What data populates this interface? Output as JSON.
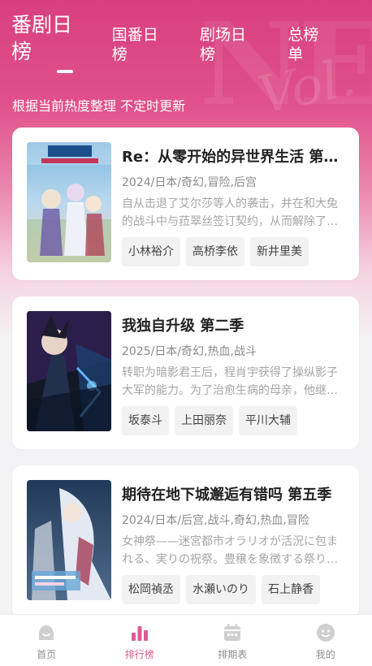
{
  "header": {
    "tabs": [
      {
        "label": "番剧日榜",
        "active": true
      },
      {
        "label": "国番日榜",
        "active": false
      },
      {
        "label": "剧场日榜",
        "active": false
      },
      {
        "label": "总榜单",
        "active": false
      }
    ],
    "subtitle": "根据当前热度整理 不定时更新"
  },
  "list": [
    {
      "title": "Re：从零开始的异世界生活 第三季",
      "meta": "2024/日本/奇幻,冒险,后宫",
      "desc": "自从击退了艾尔莎等人的袭击，并在和大兔的战斗中与菈翠丝签订契约，从而解除了诅咒之后，一行人回到了王都。",
      "cast": [
        "小林裕介",
        "高桥李依",
        "新井里美"
      ]
    },
    {
      "title": "我独自升级 第二季",
      "meta": "2025/日本/奇幻,热血,战斗",
      "desc": "转职为暗影君王后，程肖宇获得了操纵影子大军的能力。为了治愈生病的母亲，他继续挑战着更高难度的副本。",
      "cast": [
        "坂泰斗",
        "上田丽奈",
        "平川大辅"
      ]
    },
    {
      "title": "期待在地下城邂逅有错吗 第五季",
      "meta": "2024/日本/后宫,战斗,奇幻,热血,冒险",
      "desc": "女神祭——迷宮都市オラリオが活況に包まれる、実りの祝祭。豊穣を象徴する祭りで女神たちは。",
      "cast": [
        "松岡禎丞",
        "水瀬いのり",
        "石上静香"
      ]
    }
  ],
  "bottom_nav": [
    {
      "label": "首页",
      "icon": "home-icon",
      "active": false
    },
    {
      "label": "排行榜",
      "icon": "ranking-icon",
      "active": true
    },
    {
      "label": "排期表",
      "icon": "calendar-icon",
      "active": false
    },
    {
      "label": "我的",
      "icon": "profile-icon",
      "active": false
    }
  ],
  "colors": {
    "accent": "#e05a93",
    "hero": "#d8407d",
    "inactive": "#cfcfcf"
  }
}
